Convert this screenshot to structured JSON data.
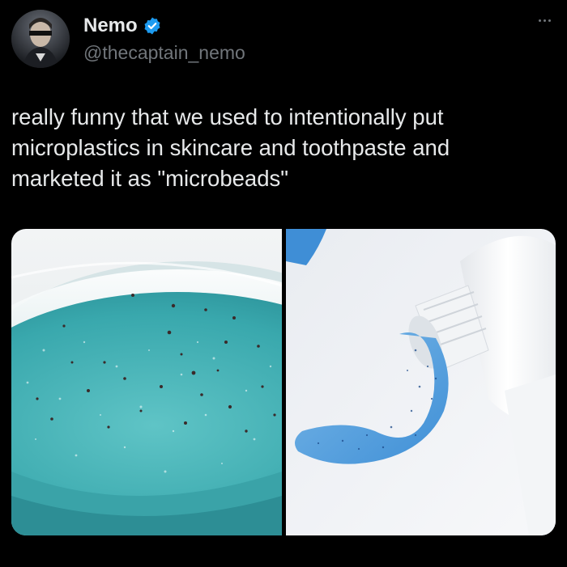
{
  "author": {
    "display_name": "Nemo",
    "handle": "@thecaptain_nemo",
    "verified": true,
    "avatar_icon": "profile-avatar"
  },
  "menu": {
    "icon": "more-options-icon"
  },
  "tweet": {
    "text": "really funny that we used to intentionally put\nmicroplastics in skincare and toothpaste and\nmarketed it as \"microbeads\""
  },
  "media": {
    "images": [
      {
        "subject": "teal-gel-with-microbeads"
      },
      {
        "subject": "blue-toothpaste-from-tube"
      }
    ]
  },
  "colors": {
    "background": "#000000",
    "text_primary": "#e7e9ea",
    "text_secondary": "#71767b",
    "verified_badge": "#1d9bf0"
  }
}
